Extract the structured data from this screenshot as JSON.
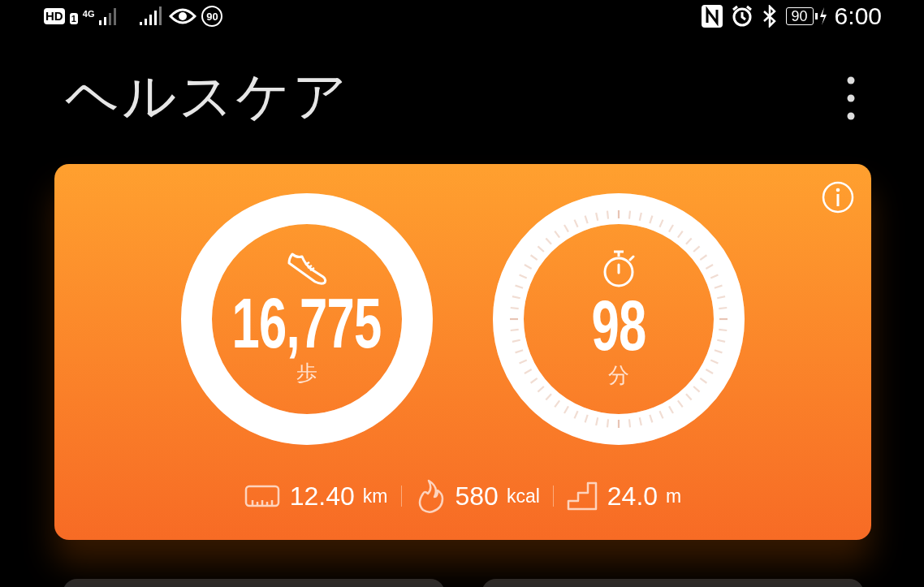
{
  "status_bar": {
    "hd_label": "HD",
    "sim_label": "1",
    "network_label": "4G",
    "rate_label": "90",
    "battery_label": "90",
    "time": "6:00"
  },
  "header": {
    "title": "ヘルスケア"
  },
  "activity": {
    "rings": [
      {
        "kind": "steps",
        "value": "16,775",
        "unit": "歩",
        "level": 1
      },
      {
        "kind": "minutes",
        "value": "98",
        "unit": "分",
        "level": 1
      }
    ],
    "stats": [
      {
        "kind": "distance",
        "value": "12.40",
        "unit": "km"
      },
      {
        "kind": "calories",
        "value": "580",
        "unit": "kcal"
      },
      {
        "kind": "climb",
        "value": "24.0",
        "unit": "m"
      }
    ]
  }
}
